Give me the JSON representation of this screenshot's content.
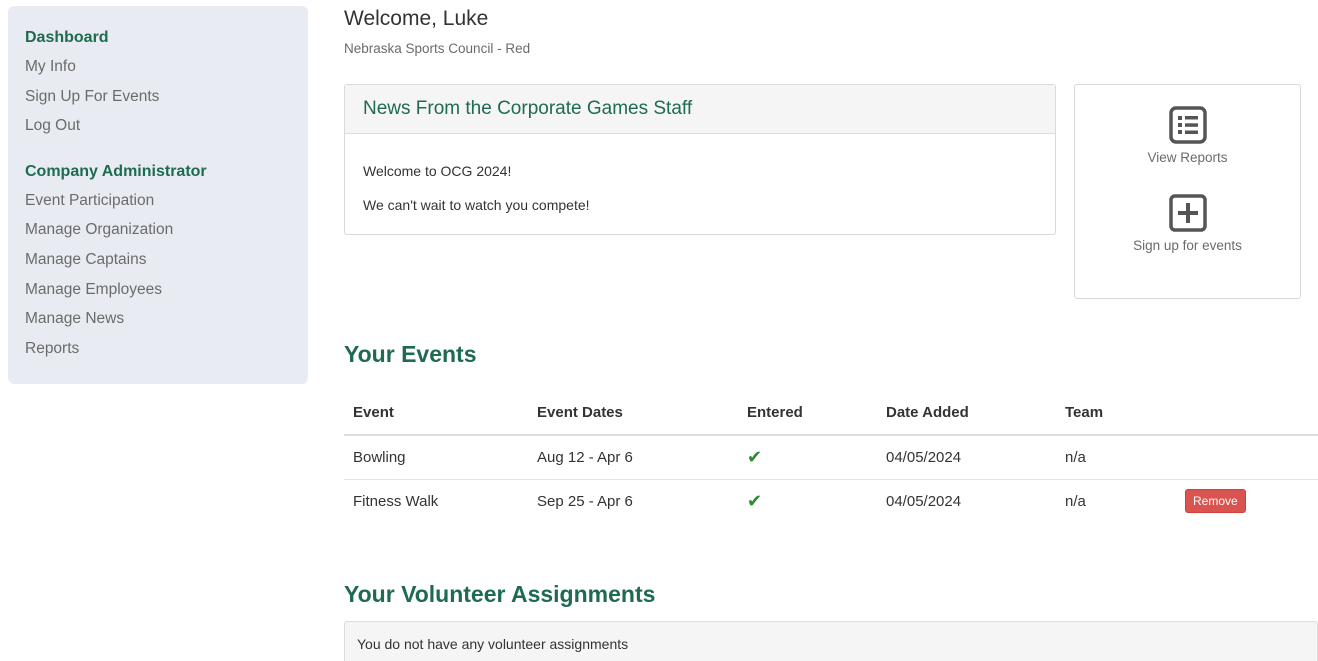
{
  "sidebar": {
    "heading1": "Dashboard",
    "links1": [
      "My Info",
      "Sign Up For Events",
      "Log Out"
    ],
    "heading2": "Company Administrator",
    "links2": [
      "Event Participation",
      "Manage Organization",
      "Manage Captains",
      "Manage Employees",
      "Manage News",
      "Reports"
    ]
  },
  "header": {
    "welcome": "Welcome, Luke",
    "subtitle": "Nebraska Sports Council - Red"
  },
  "news": {
    "title": "News From the Corporate Games Staff",
    "line1": "Welcome to OCG 2024!",
    "line2": "We can't wait to watch you compete!"
  },
  "quick_actions": {
    "view_reports": "View Reports",
    "sign_up": "Sign up for events",
    "icons": [
      "list-icon",
      "plus-square-icon"
    ]
  },
  "events": {
    "title": "Your Events",
    "columns": [
      "Event",
      "Event Dates",
      "Entered",
      "Date Added",
      "Team",
      ""
    ],
    "rows": [
      {
        "event": "Bowling",
        "dates": "Aug 12 - Apr 6",
        "entered": "✔",
        "added": "04/05/2024",
        "team": "n/a",
        "action": ""
      },
      {
        "event": "Fitness Walk",
        "dates": "Sep 25 - Apr 6",
        "entered": "✔",
        "added": "04/05/2024",
        "team": "n/a",
        "action": "Remove"
      }
    ]
  },
  "volunteer": {
    "title": "Your Volunteer Assignments",
    "empty_message": "You do not have any volunteer assignments"
  },
  "colors": {
    "brand_green": "#1e6b4f",
    "sidebar_bg": "#e8ecf2",
    "check_green": "#2e8b2e",
    "danger": "#d9534f"
  }
}
